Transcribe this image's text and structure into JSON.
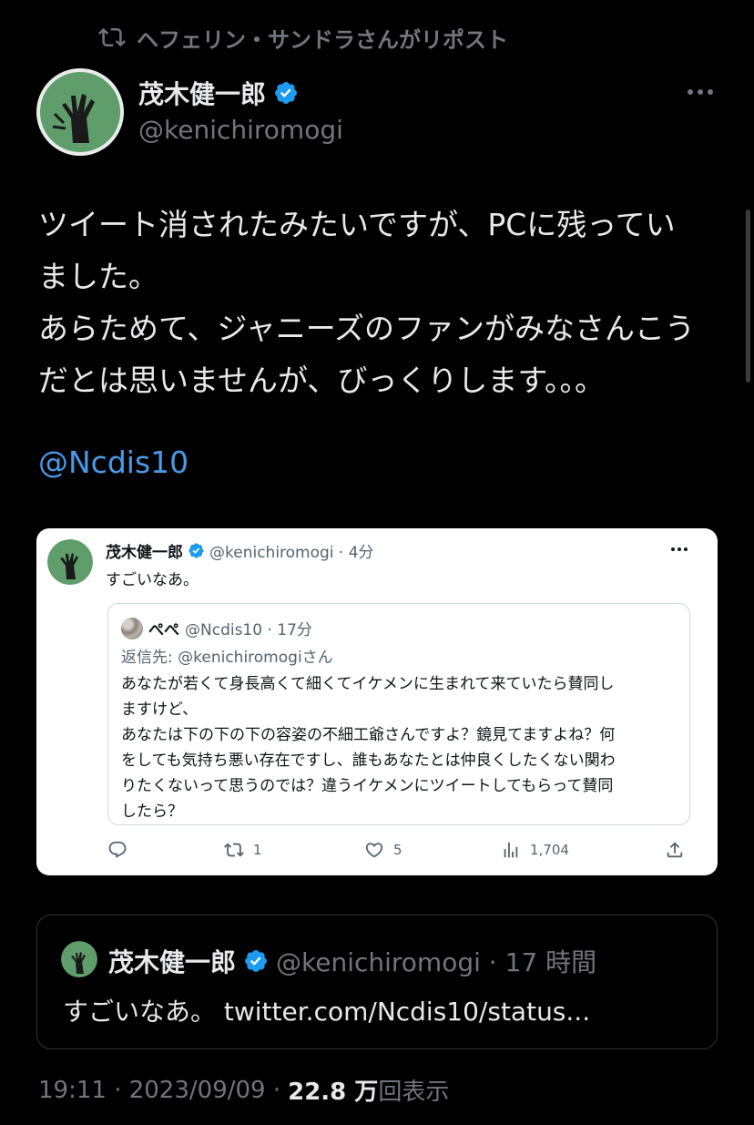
{
  "repost": {
    "label": "ヘフェリン・サンドラさんがリポスト"
  },
  "author": {
    "name": "茂木健一郎",
    "handle": "@kenichiromogi"
  },
  "tweet": {
    "lines": [
      "ツイート消されたみたいですが、PCに残ってい",
      "ました。",
      "あらためて、ジャニーズのファンがみなさんこう",
      "だとは思いませんが、びっくりします。。。"
    ],
    "mention": "@Ncdis10"
  },
  "screenshot_card": {
    "name": "茂木健一郎",
    "handle_time": "@kenichiromogi · 4分",
    "text": "すごいなあ。",
    "quoted": {
      "name": "ぺぺ",
      "handle_time": "@Ncdis10 · 17分",
      "reply_to": "返信先: @kenichiromogiさん",
      "body": [
        "あなたが若くて身長高くて細くてイケメンに生まれて来ていたら賛同し",
        "ますけど、",
        "あなたは下の下の下の容姿の不細工爺さんですよ？鏡見てますよね？何",
        "をしても気持ち悪い存在ですし、誰もあなたとは仲良くしたくない関わ",
        "りたくないって思うのでは？違うイケメンにツイートしてもらって賛同",
        "したら？"
      ]
    },
    "actions": {
      "retweets": "1",
      "likes": "5",
      "views": "1,704"
    }
  },
  "quote_tweet": {
    "name": "茂木健一郎",
    "handle_time": "@kenichiromogi · 17 時間",
    "text": "すごいなあ。 twitter.com/Ncdis10/status..."
  },
  "meta": {
    "timestamp": "19:11 · 2023/09/09 · ",
    "views": "22.8 万",
    "views_label": "回表示"
  },
  "colors": {
    "background": "#000000",
    "link": "#4a99e9",
    "verified": "#1d9bf0",
    "muted": "#71767b"
  }
}
